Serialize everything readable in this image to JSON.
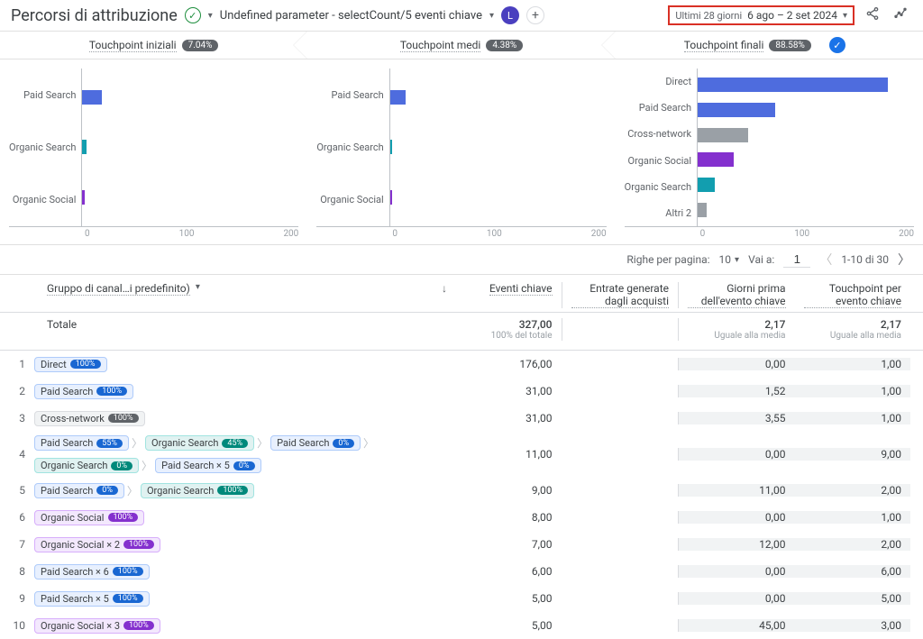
{
  "header": {
    "title": "Percorsi di attribuzione",
    "status_icon": "✓",
    "parameter": "Undefined parameter - selectCount/5 eventi chiave",
    "avatar_letter": "L",
    "date_label": "Ultimi 28 giorni",
    "date_range": "6 ago – 2 set 2024"
  },
  "stages": [
    {
      "label": "Touchpoint iniziali",
      "pct": "7.04%"
    },
    {
      "label": "Touchpoint medi",
      "pct": "4.38%"
    },
    {
      "label": "Touchpoint finali",
      "pct": "88.58%"
    }
  ],
  "chart_data": [
    {
      "type": "bar",
      "orientation": "horizontal",
      "categories": [
        "Paid Search",
        "Organic Search",
        "Organic Social"
      ],
      "values": [
        18,
        4,
        2
      ],
      "colors": [
        "#4e6cde",
        "#129eaf",
        "#8430ce"
      ],
      "xlim": [
        0,
        200
      ],
      "xticks": [
        0,
        100,
        200
      ]
    },
    {
      "type": "bar",
      "orientation": "horizontal",
      "categories": [
        "Paid Search",
        "Organic Search",
        "Organic Social"
      ],
      "values": [
        14,
        2,
        2
      ],
      "colors": [
        "#4e6cde",
        "#129eaf",
        "#8430ce"
      ],
      "xlim": [
        0,
        200
      ],
      "xticks": [
        0,
        100,
        200
      ]
    },
    {
      "type": "bar",
      "orientation": "horizontal",
      "categories": [
        "Direct",
        "Paid Search",
        "Cross-network",
        "Organic Social",
        "Organic Search",
        "Altri 2"
      ],
      "values": [
        176,
        72,
        47,
        33,
        16,
        8
      ],
      "colors": [
        "#4e6cde",
        "#4e6cde",
        "#9aa0a6",
        "#8430ce",
        "#129eaf",
        "#9aa0a6"
      ],
      "xlim": [
        0,
        200
      ],
      "xticks": [
        0,
        100,
        200
      ]
    }
  ],
  "controls": {
    "rows_label": "Righe per pagina:",
    "rows_value": "10",
    "goto_label": "Vai a:",
    "goto_value": "1",
    "range": "1-10 di 30"
  },
  "columns": {
    "dimension": "Gruppo di canal…i predefinito)",
    "metrics": [
      "Eventi chiave",
      "Entrate generate dagli acquisti",
      "Giorni prima dell'evento chiave",
      "Touchpoint per evento chiave"
    ]
  },
  "totals": {
    "label": "Totale",
    "cells": [
      {
        "main": "327,00",
        "sub": "100% del totale"
      },
      {
        "main": "",
        "sub": ""
      },
      {
        "main": "2,17",
        "sub": "Uguale alla media"
      },
      {
        "main": "2,17",
        "sub": "Uguale alla media"
      }
    ]
  },
  "rows": [
    {
      "n": 1,
      "chips": [
        {
          "t": "Direct",
          "c": "blue",
          "p": "100%"
        }
      ],
      "v": [
        "176,00",
        "",
        "0,00",
        "1,00"
      ]
    },
    {
      "n": 2,
      "chips": [
        {
          "t": "Paid Search",
          "c": "blue",
          "p": "100%"
        }
      ],
      "v": [
        "31,00",
        "",
        "1,52",
        "1,00"
      ]
    },
    {
      "n": 3,
      "chips": [
        {
          "t": "Cross-network",
          "c": "grey",
          "p": "100%"
        }
      ],
      "v": [
        "31,00",
        "",
        "3,55",
        "1,00"
      ]
    },
    {
      "n": 4,
      "chips": [
        {
          "t": "Paid Search",
          "c": "blue",
          "p": "55%"
        },
        {
          "sep": true
        },
        {
          "t": "Organic Search",
          "c": "teal",
          "p": "45%"
        },
        {
          "sep": true
        },
        {
          "t": "Paid Search",
          "c": "blue",
          "p": "0%"
        },
        {
          "sep": true
        },
        {
          "br": true
        },
        {
          "t": "Organic Search",
          "c": "teal",
          "p": "0%"
        },
        {
          "sep": true
        },
        {
          "t": "Paid Search × 5",
          "c": "blue",
          "p": "0%"
        }
      ],
      "v": [
        "11,00",
        "",
        "0,00",
        "9,00"
      ]
    },
    {
      "n": 5,
      "chips": [
        {
          "t": "Paid Search",
          "c": "blue",
          "p": "0%"
        },
        {
          "sep": true
        },
        {
          "t": "Organic Search",
          "c": "teal",
          "p": "100%"
        }
      ],
      "v": [
        "9,00",
        "",
        "11,00",
        "2,00"
      ]
    },
    {
      "n": 6,
      "chips": [
        {
          "t": "Organic Social",
          "c": "purple",
          "p": "100%"
        }
      ],
      "v": [
        "8,00",
        "",
        "0,00",
        "1,00"
      ]
    },
    {
      "n": 7,
      "chips": [
        {
          "t": "Organic Social × 2",
          "c": "purple",
          "p": "100%"
        }
      ],
      "v": [
        "7,00",
        "",
        "12,00",
        "2,00"
      ]
    },
    {
      "n": 8,
      "chips": [
        {
          "t": "Paid Search × 6",
          "c": "blue",
          "p": "100%"
        }
      ],
      "v": [
        "6,00",
        "",
        "0,00",
        "6,00"
      ]
    },
    {
      "n": 9,
      "chips": [
        {
          "t": "Paid Search × 5",
          "c": "blue",
          "p": "100%"
        }
      ],
      "v": [
        "5,00",
        "",
        "0,00",
        "5,00"
      ]
    },
    {
      "n": 10,
      "chips": [
        {
          "t": "Organic Social × 3",
          "c": "purple",
          "p": "100%"
        }
      ],
      "v": [
        "5,00",
        "",
        "45,00",
        "3,00"
      ]
    }
  ]
}
